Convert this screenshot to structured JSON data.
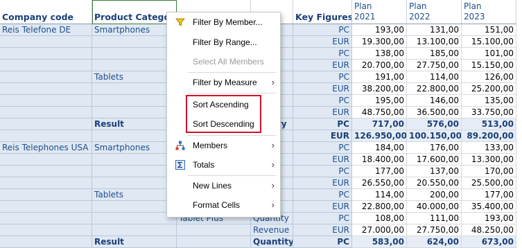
{
  "columns": {
    "company": "Company code",
    "product": "Product Categor",
    "key_figures": "Key Figures",
    "years": [
      {
        "line1": "Plan",
        "line2": "2021"
      },
      {
        "line1": "Plan",
        "line2": "2022"
      },
      {
        "line1": "Plan",
        "line2": "2023"
      }
    ]
  },
  "rows": [
    {
      "company": "Reis Telefone DE",
      "category": "Smartphones",
      "product": "",
      "keyfig": "y",
      "unit": "PC",
      "values": [
        "193,00",
        "131,00",
        "151,00"
      ],
      "type": "normal"
    },
    {
      "company": "",
      "category": "",
      "product": "",
      "keyfig": "ue",
      "unit": "EUR",
      "values": [
        "19.300,00",
        "13.100,00",
        "15.100,00"
      ],
      "type": "normal"
    },
    {
      "company": "",
      "category": "",
      "product": "",
      "keyfig": "y",
      "unit": "PC",
      "values": [
        "138,00",
        "185,00",
        "101,00"
      ],
      "type": "normal"
    },
    {
      "company": "",
      "category": "",
      "product": "",
      "keyfig": "ue",
      "unit": "EUR",
      "values": [
        "20.700,00",
        "27.750,00",
        "15.150,00"
      ],
      "type": "normal"
    },
    {
      "company": "",
      "category": "Tablets",
      "product": "",
      "keyfig": "y",
      "unit": "PC",
      "values": [
        "191,00",
        "114,00",
        "126,00"
      ],
      "type": "normal"
    },
    {
      "company": "",
      "category": "",
      "product": "",
      "keyfig": "ue",
      "unit": "EUR",
      "values": [
        "38.200,00",
        "22.800,00",
        "25.200,00"
      ],
      "type": "normal"
    },
    {
      "company": "",
      "category": "",
      "product": "",
      "keyfig": "y",
      "unit": "PC",
      "values": [
        "195,00",
        "146,00",
        "135,00"
      ],
      "type": "normal"
    },
    {
      "company": "",
      "category": "",
      "product": "",
      "keyfig": "ue",
      "unit": "EUR",
      "values": [
        "48.750,00",
        "36.500,00",
        "33.750,00"
      ],
      "type": "normal"
    },
    {
      "company": "",
      "category": "Result",
      "product": "",
      "keyfig": "uantity",
      "unit": "PC",
      "values": [
        "717,00",
        "576,00",
        "513,00"
      ],
      "type": "result"
    },
    {
      "company": "",
      "category": "",
      "product": "",
      "keyfig": "ue",
      "unit": "EUR",
      "values": [
        "126.950,00",
        "100.150,00",
        "89.200,00"
      ],
      "type": "result"
    },
    {
      "company": "Reis Telephones USA",
      "category": "Smartphones",
      "product": "",
      "keyfig": "y",
      "unit": "PC",
      "values": [
        "184,00",
        "176,00",
        "133,00"
      ],
      "type": "normal"
    },
    {
      "company": "",
      "category": "",
      "product": "",
      "keyfig": "ue",
      "unit": "EUR",
      "values": [
        "18.400,00",
        "17.600,00",
        "13.300,00"
      ],
      "type": "normal"
    },
    {
      "company": "",
      "category": "",
      "product": "",
      "keyfig": "y",
      "unit": "PC",
      "values": [
        "177,00",
        "137,00",
        "170,00"
      ],
      "type": "normal"
    },
    {
      "company": "",
      "category": "",
      "product": "",
      "keyfig": "ue",
      "unit": "EUR",
      "values": [
        "26.550,00",
        "20.550,00",
        "25.500,00"
      ],
      "type": "normal"
    },
    {
      "company": "",
      "category": "Tablets",
      "product": "",
      "keyfig": "y",
      "unit": "PC",
      "values": [
        "114,00",
        "200,00",
        "177,00"
      ],
      "type": "normal"
    },
    {
      "company": "",
      "category": "",
      "product": "",
      "keyfig": "ue",
      "unit": "EUR",
      "values": [
        "22.800,00",
        "40.000,00",
        "35.400,00"
      ],
      "type": "normal"
    },
    {
      "company": "",
      "category": "",
      "product": "Tablet Plus",
      "keyfig": "Quantity",
      "unit": "PC",
      "values": [
        "108,00",
        "111,00",
        "193,00"
      ],
      "type": "normal"
    },
    {
      "company": "",
      "category": "",
      "product": "",
      "keyfig": "Revenue",
      "unit": "EUR",
      "values": [
        "27.000,00",
        "27.750,00",
        "48.250,00"
      ],
      "type": "normal"
    },
    {
      "company": "",
      "category": "Result",
      "product": "",
      "keyfig": "Quantity",
      "unit": "PC",
      "values": [
        "583,00",
        "624,00",
        "673,00"
      ],
      "type": "result"
    }
  ],
  "menu": {
    "items": [
      {
        "label": "Filter By Member...",
        "icon": "filter-icon",
        "submenu": false,
        "disabled": false
      },
      {
        "label": "Filter By Range...",
        "icon": "",
        "submenu": false,
        "disabled": false
      },
      {
        "label": "Select All Members",
        "icon": "",
        "submenu": false,
        "disabled": true
      },
      {
        "label": "Filter by Measure",
        "icon": "",
        "submenu": true,
        "disabled": false
      },
      {
        "label": "Sort Ascending",
        "icon": "",
        "submenu": false,
        "disabled": false
      },
      {
        "label": "Sort Descending",
        "icon": "",
        "submenu": false,
        "disabled": false
      },
      {
        "label": "Members",
        "icon": "hierarchy-icon",
        "submenu": true,
        "disabled": false
      },
      {
        "label": "Totals",
        "icon": "sum-icon",
        "submenu": true,
        "disabled": false
      },
      {
        "label": "New Lines",
        "icon": "",
        "submenu": true,
        "disabled": false
      },
      {
        "label": "Format Cells",
        "icon": "",
        "submenu": true,
        "disabled": false
      }
    ],
    "chevron": "›",
    "highlight_color": "#d0112b"
  }
}
